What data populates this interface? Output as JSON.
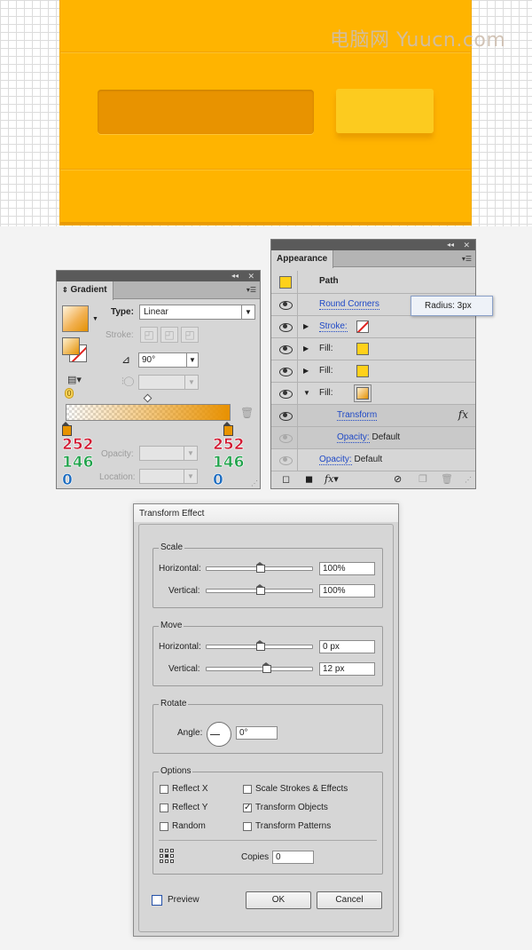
{
  "artboard": {
    "watermark": "电脑网 Yuucn.com",
    "colors": {
      "background": "#ffb400",
      "dark_bar": "#e89300",
      "button": "#fccb1f"
    }
  },
  "gradient_panel": {
    "tab": "Gradient",
    "type_label": "Type:",
    "type_value": "Linear",
    "stroke_label": "Stroke:",
    "angle_value": "90°",
    "reverse_badge": "0",
    "left_stop": {
      "r": "252",
      "g": "146",
      "b": "0"
    },
    "right_stop": {
      "r": "252",
      "g": "146",
      "b": "0"
    },
    "opacity_label": "Opacity:",
    "location_label": "Location:",
    "icons": [
      "gradient-thumbnail-icon",
      "fill-stroke-icon",
      "angle-icon",
      "aspect-ratio-icon",
      "trash-icon",
      "panel-menu-icon"
    ]
  },
  "appearance_panel": {
    "tab": "Appearance",
    "header": "Path",
    "rows": [
      {
        "label": "Round Corners"
      },
      {
        "label": "Stroke:"
      },
      {
        "label": "Fill:"
      },
      {
        "label": "Fill:"
      },
      {
        "label": "Fill:"
      },
      {
        "label": "Transform"
      },
      {
        "label": "Opacity:",
        "value": "Default"
      },
      {
        "label": "Opacity:",
        "value": "Default"
      }
    ],
    "tooltip": "Radius: 3px",
    "icons": [
      "eye-icon",
      "expand-triangle-icon",
      "fx-icon",
      "add-stroke-icon",
      "add-fill-icon",
      "clear-icon",
      "duplicate-icon",
      "trash-icon"
    ]
  },
  "transform_dialog": {
    "title": "Transform Effect",
    "scale": {
      "title": "Scale",
      "horizontal_label": "Horizontal:",
      "horizontal_value": "100%",
      "vertical_label": "Vertical:",
      "vertical_value": "100%"
    },
    "move": {
      "title": "Move",
      "horizontal_label": "Horizontal:",
      "horizontal_value": "0 px",
      "vertical_label": "Vertical:",
      "vertical_value": "12 px"
    },
    "rotate": {
      "title": "Rotate",
      "angle_label": "Angle:",
      "angle_value": "0°"
    },
    "options": {
      "title": "Options",
      "reflect_x": "Reflect X",
      "reflect_y": "Reflect Y",
      "random": "Random",
      "scale_strokes": "Scale Strokes & Effects",
      "transform_objects": "Transform Objects",
      "transform_patterns": "Transform Patterns",
      "copies_label": "Copies",
      "copies_value": "0",
      "checked": {
        "reflect_x": false,
        "reflect_y": false,
        "random": false,
        "scale_strokes": false,
        "transform_objects": true,
        "transform_patterns": false
      }
    },
    "preview_label": "Preview",
    "ok_label": "OK",
    "cancel_label": "Cancel"
  }
}
